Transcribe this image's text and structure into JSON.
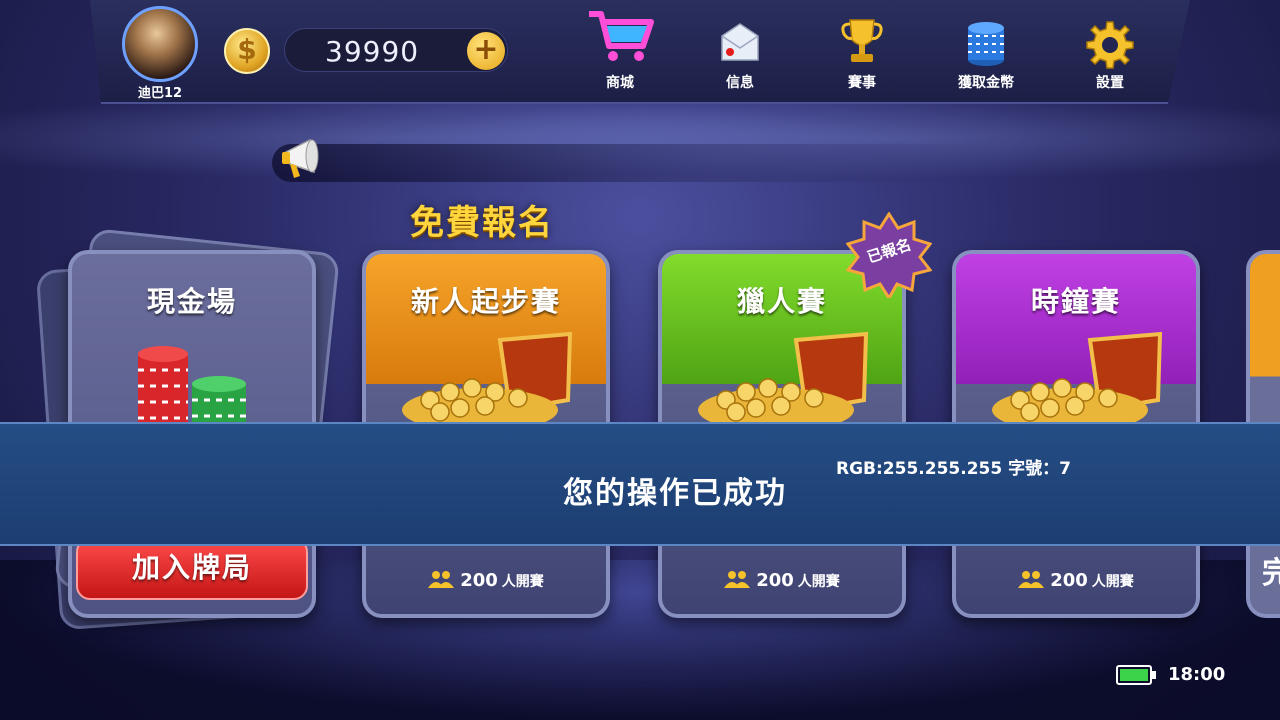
{
  "header": {
    "username": "迪巴12",
    "coins": "39990",
    "add_symbol": "+",
    "coin_symbol": "$"
  },
  "nav": [
    {
      "label": "商城",
      "icon": "shopping-cart-icon"
    },
    {
      "label": "信息",
      "icon": "mail-icon"
    },
    {
      "label": "賽事",
      "icon": "trophy-icon"
    },
    {
      "label": "獲取金幣",
      "icon": "chips-stack-icon"
    },
    {
      "label": "設置",
      "icon": "gear-icon"
    }
  ],
  "section_title": "免費報名",
  "cards": [
    {
      "title": "現金場",
      "button": "加入牌局",
      "color": "#c41616"
    },
    {
      "title": "新人起步賽",
      "players": "200",
      "players_unit": "人開賽",
      "color": "#f0a020"
    },
    {
      "title": "獵人賽",
      "players": "200",
      "players_unit": "人開賽",
      "badge": "已報名",
      "color": "#6cc51f"
    },
    {
      "title": "時鐘賽",
      "players": "200",
      "players_unit": "人開賽",
      "color": "#b52ed3"
    }
  ],
  "edge_card_glyph": "完",
  "toast": {
    "message": "您的操作已成功",
    "meta": "RGB:255.255.255  字號：7"
  },
  "status": {
    "time": "18:00",
    "battery": "full"
  }
}
